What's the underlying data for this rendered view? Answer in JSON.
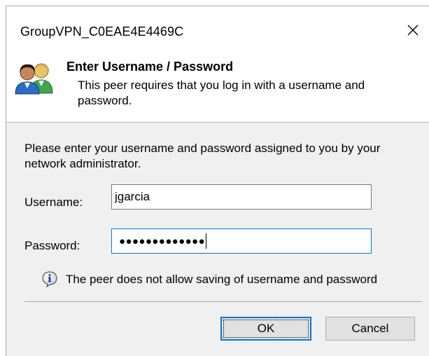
{
  "window": {
    "title": "GroupVPN_C0EAE4E4469C"
  },
  "header": {
    "icon": "users-icon",
    "title": "Enter Username / Password",
    "subtitle": "This peer requires that you log in with a username and password."
  },
  "form": {
    "instruction": "Please enter your username and password assigned to you by your network administrator.",
    "username_label": "Username:",
    "username_value": "jgarcia",
    "password_label": "Password:",
    "password_mask": "●●●●●●●●●●●●●",
    "info_icon": "info-icon",
    "info_text": "The peer does not allow saving of username and password"
  },
  "buttons": {
    "ok": "OK",
    "cancel": "Cancel"
  },
  "colors": {
    "focus_border": "#0078d7",
    "dialog_bg": "#f0f0f0",
    "banner_bg": "#ffffff"
  }
}
